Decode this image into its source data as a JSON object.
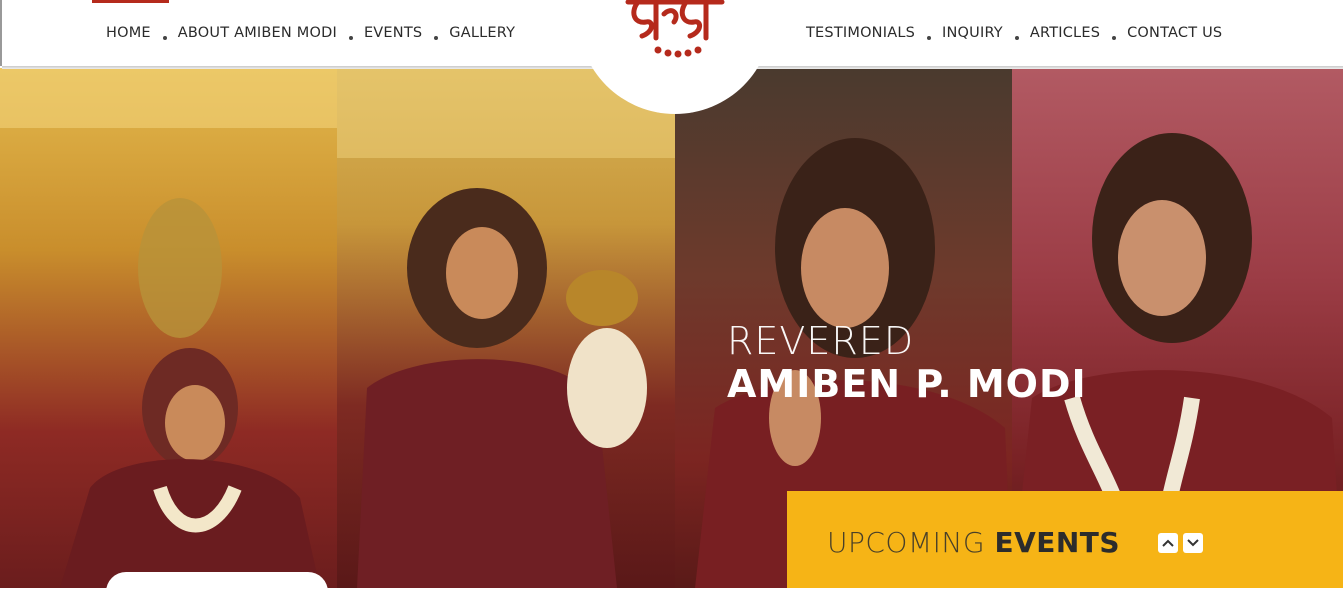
{
  "nav": {
    "left": [
      "HOME",
      "ABOUT AMIBEN MODI",
      "EVENTS",
      "GALLERY"
    ],
    "right": [
      "TESTIMONIALS",
      "INQUIRY",
      "ARTICLES",
      "CONTACT US"
    ]
  },
  "logo": {
    "text": "श्री श्री",
    "color": "#b52a1c"
  },
  "hero": {
    "line1": "REVERED",
    "line2": "AMIBEN P. MODI"
  },
  "events": {
    "title_light": "UPCOMING",
    "title_bold": "EVENTS",
    "up_icon": "chevron-up-icon",
    "down_icon": "chevron-down-icon",
    "color": "#f6b416"
  }
}
